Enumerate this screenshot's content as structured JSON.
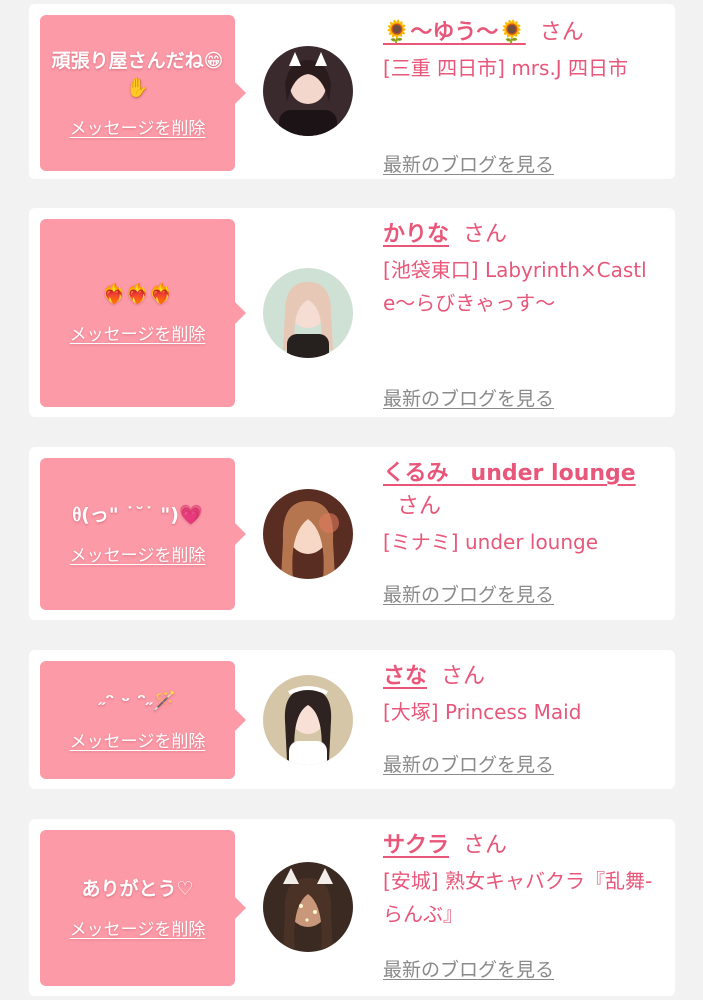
{
  "common": {
    "delete_label": "メッセージを削除",
    "blog_label": "最新のブログを見る",
    "honorific": "さん"
  },
  "messages": [
    {
      "message": "頑張り屋さんだね😁✋",
      "name": "🌻〜ゆう〜🌻",
      "shop": "[三重 四日市] mrs.J 四日市",
      "avatar_icon": "profile-photo"
    },
    {
      "message": "❤️‍🔥❤️‍🔥❤️‍🔥",
      "name": "かりな",
      "shop": "[池袋東口] Labyrinth×Castle〜らびきゃっす〜",
      "avatar_icon": "profile-photo"
    },
    {
      "message": "ᦲ(っ\" ˙˘˙ \")💗",
      "name": "くるみ　under lounge",
      "shop": "[ミナミ] under lounge",
      "avatar_icon": "profile-photo"
    },
    {
      "message": "˶ᵔ ᵕ ᵔ˶🪄",
      "name": "さな",
      "shop": "[大塚] Princess Maid",
      "avatar_icon": "profile-photo"
    },
    {
      "message": "ありがとう♡",
      "name": "サクラ",
      "shop": "[安城] 熟女キャバクラ『乱舞-らんぶ』",
      "avatar_icon": "profile-photo"
    }
  ],
  "colors": {
    "bubble": "#fd9aa7",
    "accent": "#e8577a",
    "muted": "#8a8a8a",
    "background": "#f2f2f2",
    "card": "#ffffff"
  }
}
